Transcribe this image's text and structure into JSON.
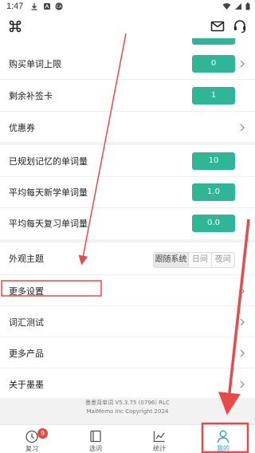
{
  "status": {
    "time": "1:47"
  },
  "rows": {
    "buy_limit": {
      "label": "购买单词上限",
      "value": "0"
    },
    "remaining_cards": {
      "label": "剩余补签卡",
      "value": "1"
    },
    "coupon": {
      "label": "优惠券"
    },
    "planned_words": {
      "label": "已规划记忆的单词量",
      "value": "10"
    },
    "avg_new": {
      "label": "平均每天新学单词量",
      "value": "1.0"
    },
    "avg_review": {
      "label": "平均每天复习单词量",
      "value": "0.0"
    },
    "theme": {
      "label": "外观主题",
      "options": [
        "跟随系统",
        "日间",
        "夜间"
      ],
      "selected": "跟随系统"
    },
    "more_settings": {
      "label": "更多设置"
    },
    "vocab_test": {
      "label": "词汇测试"
    },
    "more_products": {
      "label": "更多产品"
    },
    "about": {
      "label": "关于墨墨"
    }
  },
  "footer": {
    "version": "墨墨背单词 V5.3.75 (0796) RLC",
    "copyright": "MaiMemo Inc Copyright 2024"
  },
  "tabs": [
    {
      "label": "复习",
      "badge": "9"
    },
    {
      "label": "选词"
    },
    {
      "label": "统计"
    },
    {
      "label": "我的",
      "active": true
    }
  ],
  "colors": {
    "accent": "#2fb696",
    "highlight": "#e84a4a",
    "badge": "#e8483c"
  }
}
